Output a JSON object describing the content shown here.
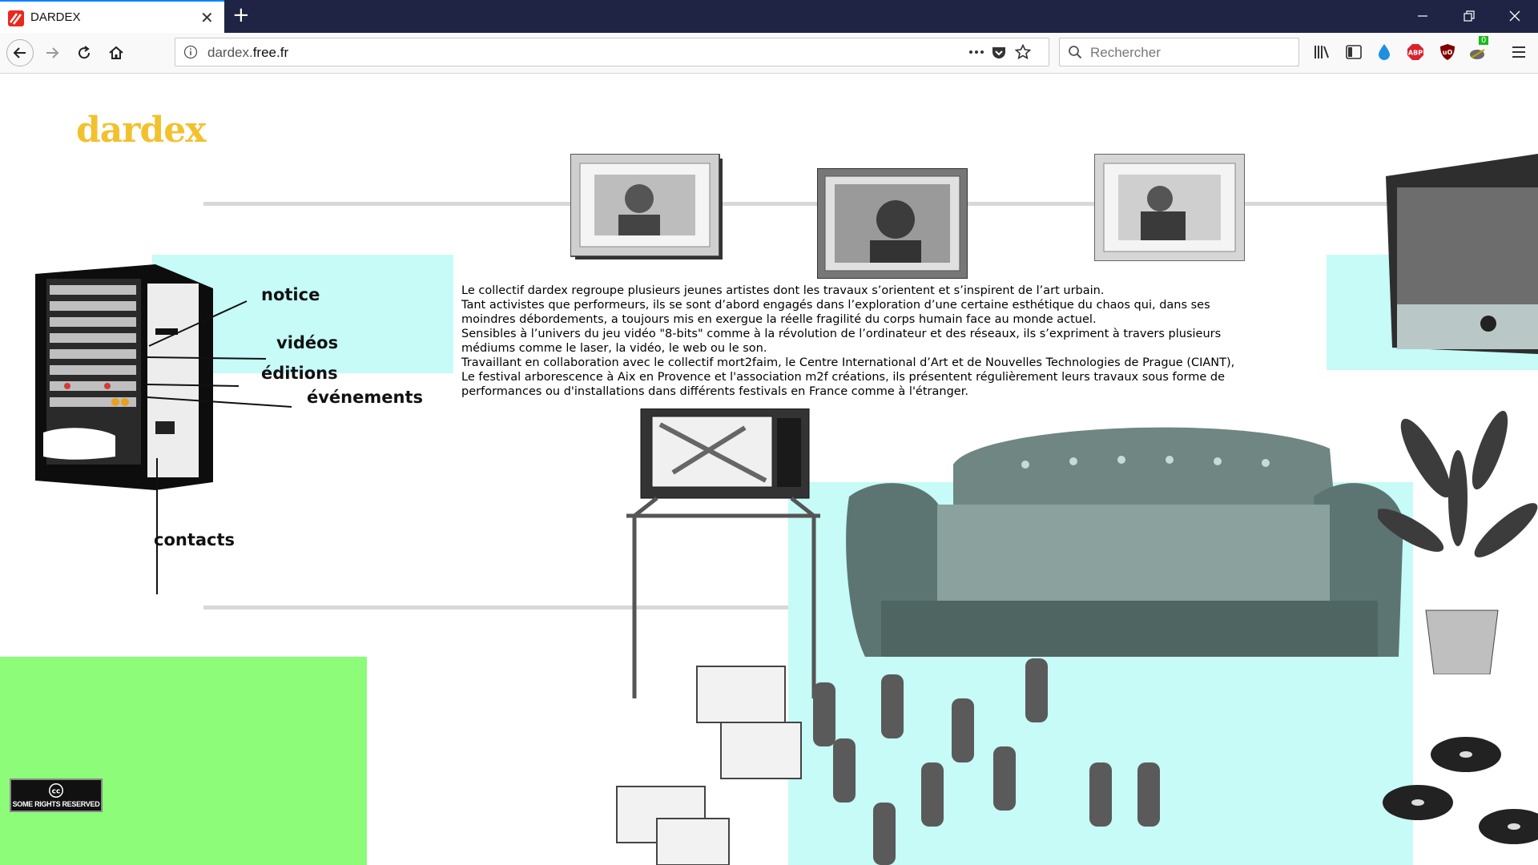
{
  "browser": {
    "tab_title": "DARDEX",
    "new_tab": "+",
    "close_tab": "✕",
    "url_host": "dardex.",
    "url_domain": "free.fr",
    "search_placeholder": "Rechercher",
    "addon_badge": "0"
  },
  "page": {
    "logo": "dardex",
    "nav": {
      "notice": "notice",
      "videos": "vidéos",
      "editions": "éditions",
      "evenements": "événements",
      "contacts": "contacts"
    },
    "intro": [
      "Le collectif dardex regroupe plusieurs jeunes artistes dont les travaux s’orientent et s’inspirent de l’art urbain.",
      "Tant activistes que performeurs, ils se sont d’abord engagés dans l’exploration d’une certaine esthétique du chaos qui, dans ses moindres débordements, a toujours mis en exergue la réelle fragilité du corps humain face au monde actuel.",
      "Sensibles à l’univers du jeu vidéo \"8-bits\" comme à la révolution de l’ordinateur et des réseaux, ils s’expriment à travers plusieurs médiums comme le laser, la vidéo, le web ou le son.",
      "Travaillant en collaboration avec le collectif mort2faim, le Centre International d’Art et de Nouvelles Technologies de Prague (CIANT), Le festival arborescence à Aix en Provence et l'association m2f créations, ils présentent régulièrement leurs travaux sous forme de performances ou d'installations dans différents festivals en France comme à l'étranger."
    ],
    "cc_badge": "SOME RIGHTS RESERVED",
    "colors": {
      "logo": "#f2c12e",
      "cyan_panel": "#c6fbf7",
      "green_panel": "#8dfc79"
    }
  }
}
